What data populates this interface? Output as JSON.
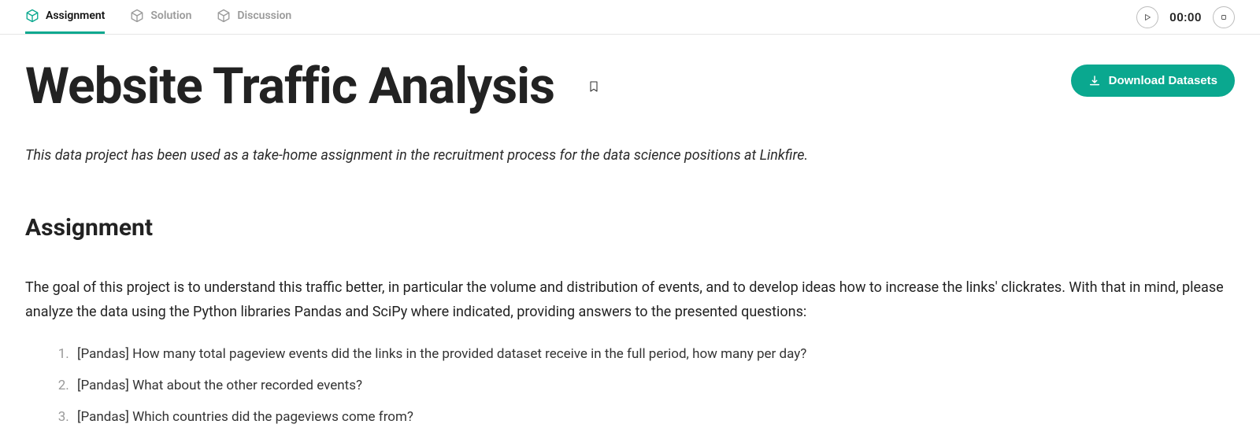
{
  "tabs": [
    {
      "label": "Assignment"
    },
    {
      "label": "Solution"
    },
    {
      "label": "Discussion"
    }
  ],
  "timer": "00:00",
  "title": "Website Traffic Analysis",
  "download_label": "Download Datasets",
  "intro": "This data project has been used as a take-home assignment in the recruitment process for the data science positions at Linkfire.",
  "section_heading": "Assignment",
  "body_text": "The goal of this project is to understand this traffic better, in particular the volume and distribution of events, and to develop ideas how to increase the links' clickrates. With that in mind, please analyze the data using the Python libraries Pandas and SciPy where indicated, providing answers to the presented questions:",
  "questions": [
    "[Pandas] How many total pageview events did the links in the provided dataset receive in the full period, how many per day?",
    "[Pandas] What about the other recorded events?",
    "[Pandas] Which countries did the pageviews come from?"
  ]
}
